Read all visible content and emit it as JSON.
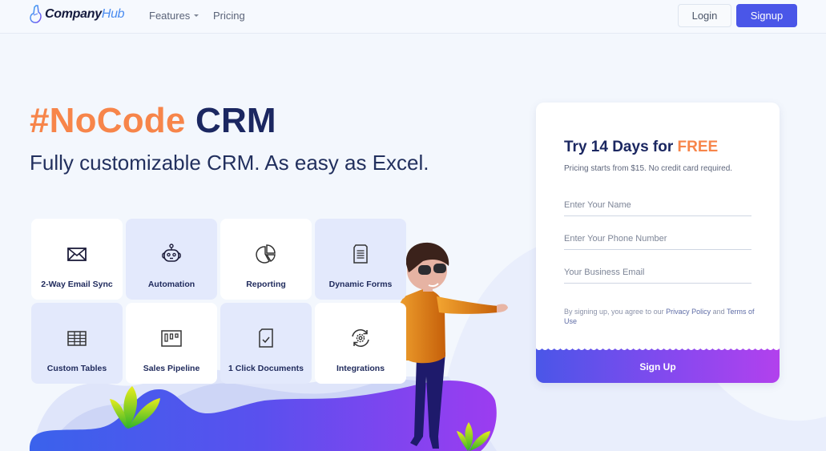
{
  "nav": {
    "brand_main": "Company",
    "brand_accent": "Hub",
    "features_label": "Features",
    "pricing_label": "Pricing",
    "login_label": "Login",
    "signup_label": "Signup"
  },
  "hero": {
    "title_accent": "#NoCode",
    "title_main": "CRM",
    "subtitle": "Fully customizable CRM. As easy as Excel."
  },
  "features": [
    {
      "label": "2-Way Email Sync",
      "icon": "envelope-icon"
    },
    {
      "label": "Automation",
      "icon": "robot-icon"
    },
    {
      "label": "Reporting",
      "icon": "pie-chart-icon"
    },
    {
      "label": "Dynamic Forms",
      "icon": "document-icon"
    },
    {
      "label": "Custom Tables",
      "icon": "table-icon"
    },
    {
      "label": "Sales Pipeline",
      "icon": "pipeline-icon"
    },
    {
      "label": "1 Click Documents",
      "icon": "document-check-icon"
    },
    {
      "label": "Integrations",
      "icon": "gear-sync-icon"
    }
  ],
  "signup_card": {
    "title_main": "Try 14 Days for ",
    "title_accent": "FREE",
    "note": "Pricing starts from $15. No credit card required.",
    "name_placeholder": "Enter Your Name",
    "phone_placeholder": "Enter Your Phone Number",
    "email_placeholder": "Your Business Email",
    "terms_prefix": "By signing up, you agree to our ",
    "privacy_link": "Privacy Policy",
    "terms_mid": " and ",
    "terms_link": "Terms of Use",
    "button_label": "Sign Up"
  },
  "colors": {
    "accent_orange": "#f7854a",
    "navy": "#1b2761",
    "primary_blue": "#4a56e8",
    "gradient_end": "#b241ed"
  }
}
